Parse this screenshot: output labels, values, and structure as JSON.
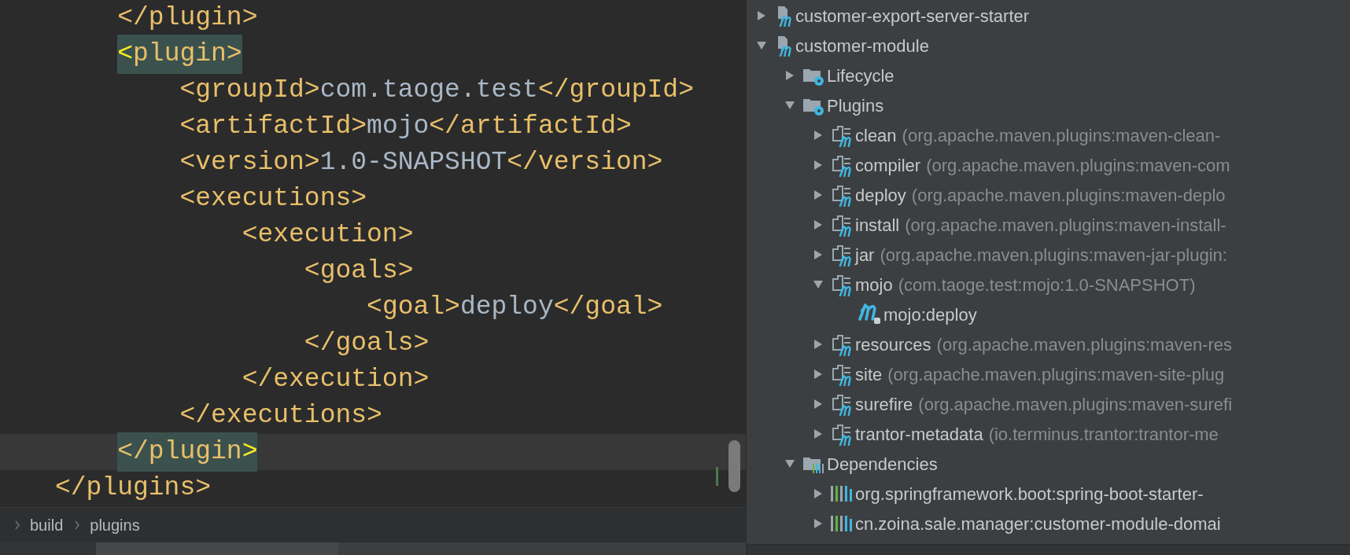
{
  "editor": {
    "lines": [
      {
        "current": false,
        "parts": [
          {
            "kind": "tag",
            "text": "    </plugin>",
            "matched": false
          }
        ]
      },
      {
        "current": false,
        "parts": [
          {
            "kind": "brace",
            "text": "    <",
            "matched": true
          },
          {
            "kind": "tag",
            "text": "plugin>",
            "matched": true
          }
        ]
      },
      {
        "current": false,
        "parts": [
          {
            "kind": "tag",
            "text": "        <groupId>",
            "matched": false
          },
          {
            "kind": "value",
            "text": "com.taoge.test",
            "matched": false
          },
          {
            "kind": "tag",
            "text": "</groupId>",
            "matched": false
          }
        ]
      },
      {
        "current": false,
        "parts": [
          {
            "kind": "tag",
            "text": "        <artifactId>",
            "matched": false
          },
          {
            "kind": "value",
            "text": "mojo",
            "matched": false
          },
          {
            "kind": "tag",
            "text": "</artifactId>",
            "matched": false
          }
        ]
      },
      {
        "current": false,
        "parts": [
          {
            "kind": "tag",
            "text": "        <version>",
            "matched": false
          },
          {
            "kind": "value",
            "text": "1.0-SNAPSHOT",
            "matched": false
          },
          {
            "kind": "tag",
            "text": "</version>",
            "matched": false
          }
        ]
      },
      {
        "current": false,
        "parts": [
          {
            "kind": "tag",
            "text": "        <executions>",
            "matched": false
          }
        ]
      },
      {
        "current": false,
        "parts": [
          {
            "kind": "tag",
            "text": "            <execution>",
            "matched": false
          }
        ]
      },
      {
        "current": false,
        "parts": [
          {
            "kind": "tag",
            "text": "                <goals>",
            "matched": false
          }
        ]
      },
      {
        "current": false,
        "parts": [
          {
            "kind": "tag",
            "text": "                    <goal>",
            "matched": false
          },
          {
            "kind": "value",
            "text": "deploy",
            "matched": false
          },
          {
            "kind": "tag",
            "text": "</goal>",
            "matched": false
          }
        ]
      },
      {
        "current": false,
        "parts": [
          {
            "kind": "tag",
            "text": "                </goals>",
            "matched": false
          }
        ]
      },
      {
        "current": false,
        "parts": [
          {
            "kind": "tag",
            "text": "            </execution>",
            "matched": false
          }
        ]
      },
      {
        "current": false,
        "parts": [
          {
            "kind": "tag",
            "text": "        </executions>",
            "matched": false
          }
        ]
      },
      {
        "current": true,
        "parts": [
          {
            "kind": "tag",
            "text": "    </plugin",
            "matched": true
          },
          {
            "kind": "brace",
            "text": ">",
            "matched": true
          }
        ]
      },
      {
        "current": false,
        "parts": [
          {
            "kind": "tag",
            "text": "</plugins>",
            "matched": false
          }
        ]
      }
    ]
  },
  "breadcrumb": [
    "build",
    "plugins"
  ],
  "tree": [
    {
      "kind": "module",
      "label": "customer-export-server-starter",
      "expanded": false
    },
    {
      "kind": "module",
      "label": "customer-module",
      "expanded": true,
      "children": [
        {
          "kind": "settings-folder",
          "label": "Lifecycle",
          "expanded": false
        },
        {
          "kind": "settings-folder",
          "label": "Plugins",
          "expanded": true,
          "children": [
            {
              "kind": "plugin",
              "label": "clean",
              "detail": "(org.apache.maven.plugins:maven-clean-",
              "expanded": false
            },
            {
              "kind": "plugin",
              "label": "compiler",
              "detail": "(org.apache.maven.plugins:maven-com",
              "expanded": false
            },
            {
              "kind": "plugin",
              "label": "deploy",
              "detail": "(org.apache.maven.plugins:maven-deplo",
              "expanded": false
            },
            {
              "kind": "plugin",
              "label": "install",
              "detail": "(org.apache.maven.plugins:maven-install-",
              "expanded": false
            },
            {
              "kind": "plugin",
              "label": "jar",
              "detail": "(org.apache.maven.plugins:maven-jar-plugin:",
              "expanded": false
            },
            {
              "kind": "plugin",
              "label": "mojo",
              "detail": "(com.taoge.test:mojo:1.0-SNAPSHOT)",
              "expanded": true,
              "children": [
                {
                  "kind": "goal",
                  "label": "mojo:deploy"
                }
              ]
            },
            {
              "kind": "plugin",
              "label": "resources",
              "detail": "(org.apache.maven.plugins:maven-res",
              "expanded": false
            },
            {
              "kind": "plugin",
              "label": "site",
              "detail": "(org.apache.maven.plugins:maven-site-plug",
              "expanded": false
            },
            {
              "kind": "plugin",
              "label": "surefire",
              "detail": "(org.apache.maven.plugins:maven-surefi",
              "expanded": false
            },
            {
              "kind": "plugin",
              "label": "trantor-metadata",
              "detail": "(io.terminus.trantor:trantor-me",
              "expanded": false
            }
          ]
        },
        {
          "kind": "library-folder",
          "label": "Dependencies",
          "expanded": true,
          "children": [
            {
              "kind": "library",
              "label": "org.springframework.boot:spring-boot-starter-",
              "expanded": false
            },
            {
              "kind": "library",
              "label": "cn.zoina.sale.manager:customer-module-domai",
              "expanded": false
            }
          ]
        }
      ]
    }
  ]
}
